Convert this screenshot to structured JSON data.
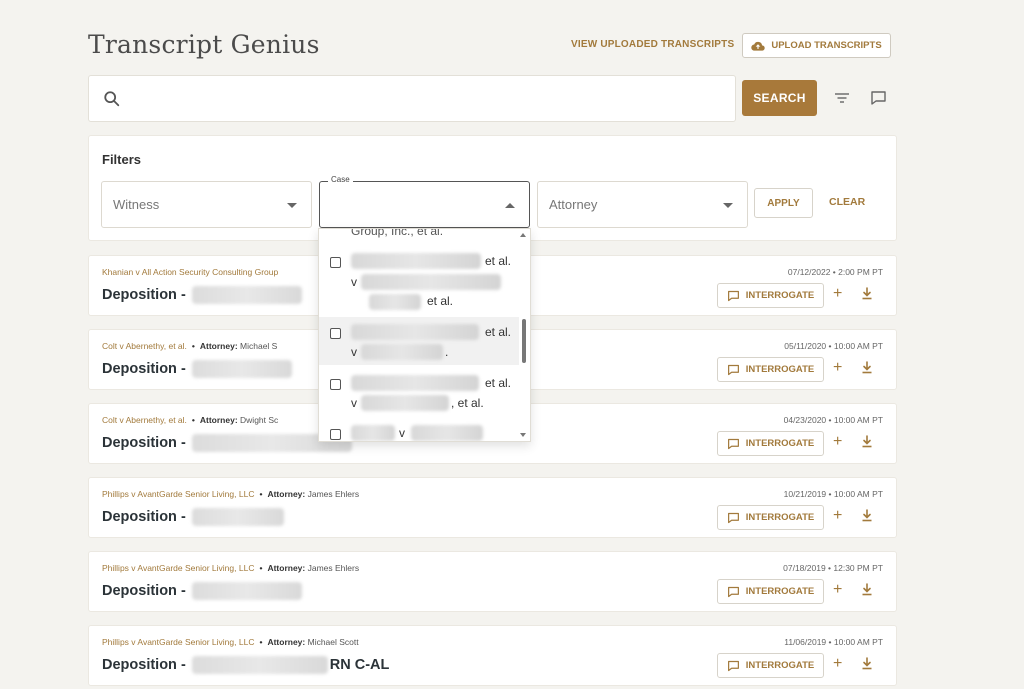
{
  "header": {
    "app_title": "Transcript Genius",
    "view_uploaded_label": "VIEW UPLOADED TRANSCRIPTS",
    "upload_label": "UPLOAD TRANSCRIPTS"
  },
  "search": {
    "value": "",
    "button_label": "SEARCH"
  },
  "filters": {
    "title": "Filters",
    "witness": {
      "placeholder": "Witness"
    },
    "case": {
      "label": "Case",
      "value": ""
    },
    "attorney": {
      "placeholder": "Attorney"
    },
    "apply_label": "APPLY",
    "clear_label": "CLEAR"
  },
  "case_dropdown": {
    "partial_top": "Group, Inc., et al.",
    "options": [
      {
        "line1_suffix": "et al.",
        "line2_prefix": "v",
        "line3_suffix": "et al."
      },
      {
        "line1_suffix": "et al.",
        "line2_prefix": "v",
        "line2_suffix": "."
      },
      {
        "line1_suffix": "et al.",
        "line2_prefix": "v",
        "line2_suffix": ", et al."
      },
      {
        "line1_mid": "v"
      }
    ]
  },
  "transcripts": [
    {
      "case": "Khanian v All Action Security Consulting Group",
      "attorney_label": "",
      "attorney": "",
      "date": "07/12/2022 • 2:00 PM PT",
      "title": "Deposition -",
      "title_suffix": ""
    },
    {
      "case": "Colt v Abernethy, et al.",
      "attorney_label": "Attorney:",
      "attorney": "Michael S",
      "date": "05/11/2020 • 10:00 AM PT",
      "title": "Deposition -",
      "title_suffix": ""
    },
    {
      "case": "Colt v Abernethy, et al.",
      "attorney_label": "Attorney:",
      "attorney": "Dwight Sc",
      "date": "04/23/2020 • 10:00 AM PT",
      "title": "Deposition -",
      "title_suffix": ""
    },
    {
      "case": "Phillips v AvantGarde Senior Living, LLC",
      "attorney_label": "Attorney:",
      "attorney": "James Ehlers",
      "date": "10/21/2019 • 10:00 AM PT",
      "title": "Deposition -",
      "title_suffix": ""
    },
    {
      "case": "Phillips v AvantGarde Senior Living, LLC",
      "attorney_label": "Attorney:",
      "attorney": "James Ehlers",
      "date": "07/18/2019 • 12:30 PM PT",
      "title": "Deposition -",
      "title_suffix": ""
    },
    {
      "case": "Phillips v AvantGarde Senior Living, LLC",
      "attorney_label": "Attorney:",
      "attorney": "Michael Scott",
      "date": "11/06/2019 • 10:00 AM PT",
      "title": "Deposition -",
      "title_suffix": "RN C-AL"
    }
  ],
  "card_actions": {
    "interrogate_label": "INTERROGATE",
    "plus": "+"
  },
  "colors": {
    "accent": "#a8793a",
    "background": "#f4f3ef"
  }
}
